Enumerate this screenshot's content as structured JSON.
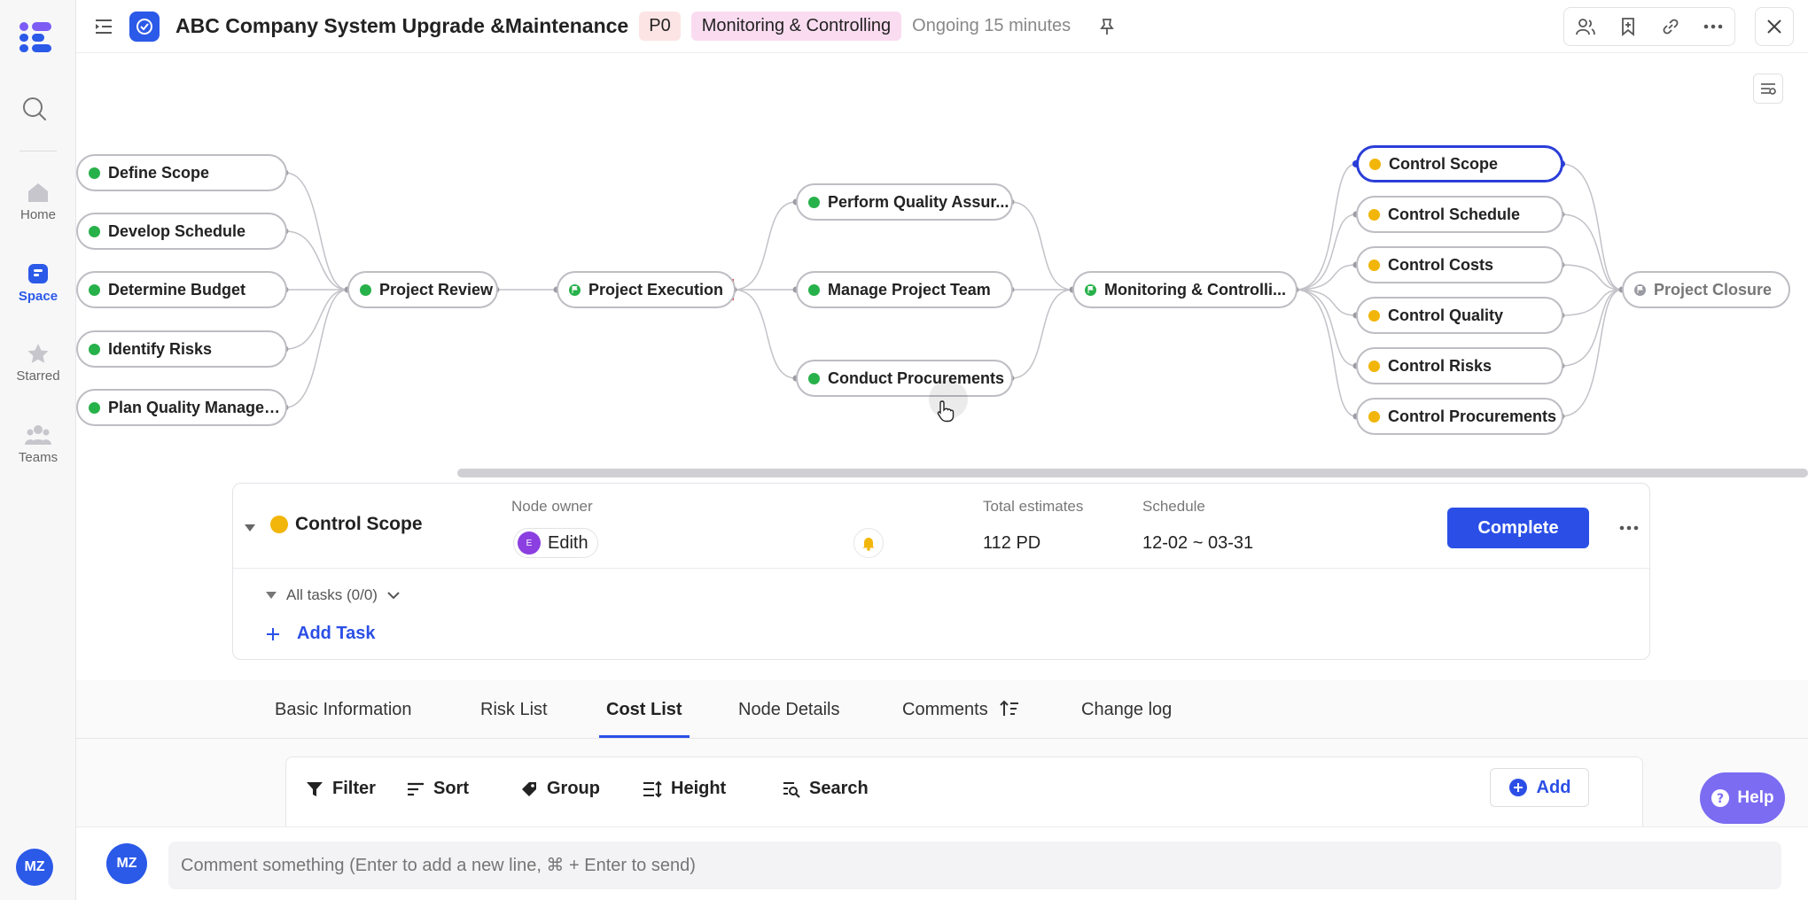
{
  "sidebar": {
    "items": [
      {
        "label": "Home",
        "icon": "home-icon"
      },
      {
        "label": "Space",
        "icon": "space-icon"
      },
      {
        "label": "Starred",
        "icon": "star-icon"
      },
      {
        "label": "Teams",
        "icon": "teams-icon"
      }
    ],
    "user_initials": "MZ"
  },
  "header": {
    "title": "ABC Company System Upgrade &Maintenance",
    "priority": "P0",
    "phase": "Monitoring & Controlling",
    "status": "Ongoing 15 minutes"
  },
  "diagram": {
    "nodes": {
      "define_scope": "Define Scope",
      "develop_schedule": "Develop Schedule",
      "determine_budget": "Determine Budget",
      "identify_risks": "Identify Risks",
      "plan_quality": "Plan Quality Managem...",
      "project_review": "Project Review",
      "project_execution": "Project Execution",
      "perform_quality": "Perform Quality Assur...",
      "manage_team": "Manage Project Team",
      "conduct_procurements": "Conduct Procurements",
      "monitoring": "Monitoring & Controlli...",
      "control_scope": "Control Scope",
      "control_schedule": "Control Schedule",
      "control_costs": "Control Costs",
      "control_quality": "Control Quality",
      "control_risks": "Control Risks",
      "control_procurements": "Control Procurements",
      "project_closure": "Project Closure"
    }
  },
  "panel": {
    "node_name": "Control Scope",
    "owner_label": "Node owner",
    "owner_name": "Edith",
    "owner_initial": "E",
    "estimates_label": "Total estimates",
    "estimates_value": "112 PD",
    "schedule_label": "Schedule",
    "schedule_value": "12-02 ~ 03-31",
    "complete_label": "Complete",
    "all_tasks": "All tasks (0/0)",
    "add_task": "Add Task"
  },
  "tabs": [
    {
      "label": "Basic Information"
    },
    {
      "label": "Risk List"
    },
    {
      "label": "Cost List"
    },
    {
      "label": "Node Details"
    },
    {
      "label": "Comments"
    },
    {
      "label": "Change log"
    }
  ],
  "toolbar": {
    "filter": "Filter",
    "sort": "Sort",
    "group": "Group",
    "height": "Height",
    "search": "Search",
    "add": "Add"
  },
  "help_label": "Help",
  "comment": {
    "user_initials": "MZ",
    "placeholder": "Comment something (Enter to add a new line, ⌘ + Enter to send)"
  }
}
